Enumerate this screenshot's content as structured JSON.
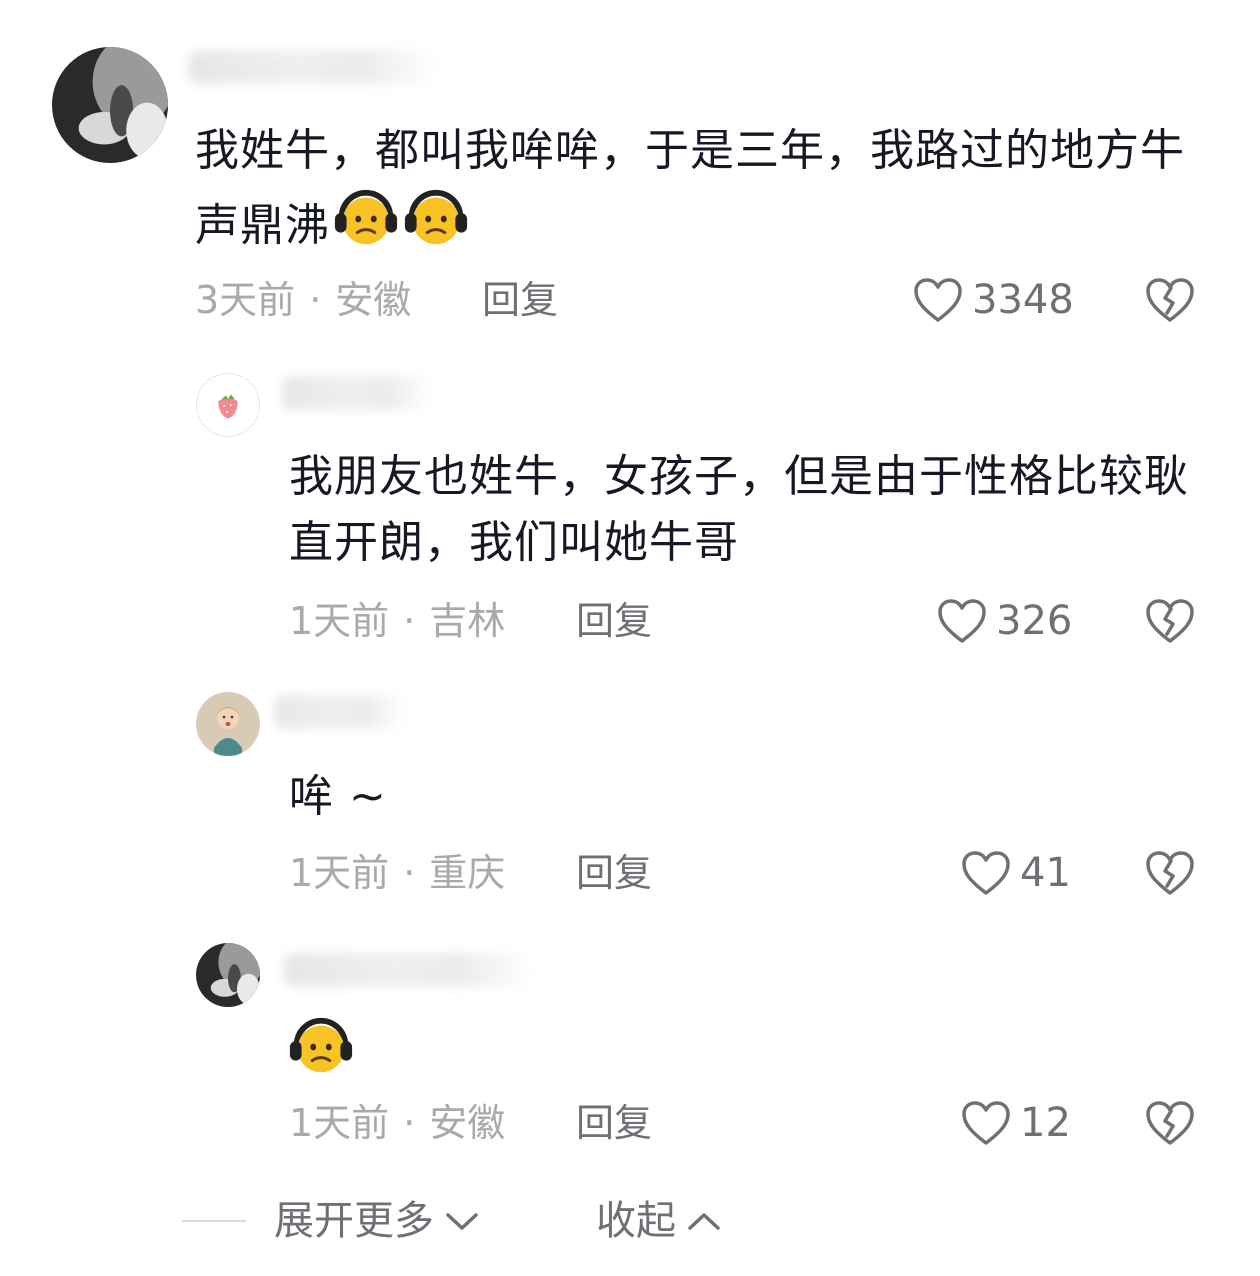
{
  "comments": [
    {
      "text": "我姓牛，都叫我哞哞，于是三年，我路过的地方牛声鼎沸",
      "emoji_icons": [
        "headphone-face-emoji",
        "headphone-face-emoji"
      ],
      "time": "3天前",
      "location": "安徽",
      "reply_label": "回复",
      "likes": "3348"
    },
    {
      "text": "我朋友也姓牛，女孩子，但是由于性格比较耿直开朗，我们叫她牛哥",
      "time": "1天前",
      "location": "吉林",
      "reply_label": "回复",
      "likes": "326"
    },
    {
      "text": "哞 ~",
      "time": "1天前",
      "location": "重庆",
      "reply_label": "回复",
      "likes": "41"
    },
    {
      "text": "",
      "emoji_icons": [
        "headphone-face-emoji"
      ],
      "time": "1天前",
      "location": "安徽",
      "reply_label": "回复",
      "likes": "12"
    }
  ],
  "separator": "·",
  "footer": {
    "expand_label": "展开更多",
    "collapse_label": "收起"
  },
  "colors": {
    "text_primary": "#161823",
    "text_meta": "#a8a9ad",
    "text_action": "#6f7076",
    "emoji_face": "#f7c325"
  }
}
